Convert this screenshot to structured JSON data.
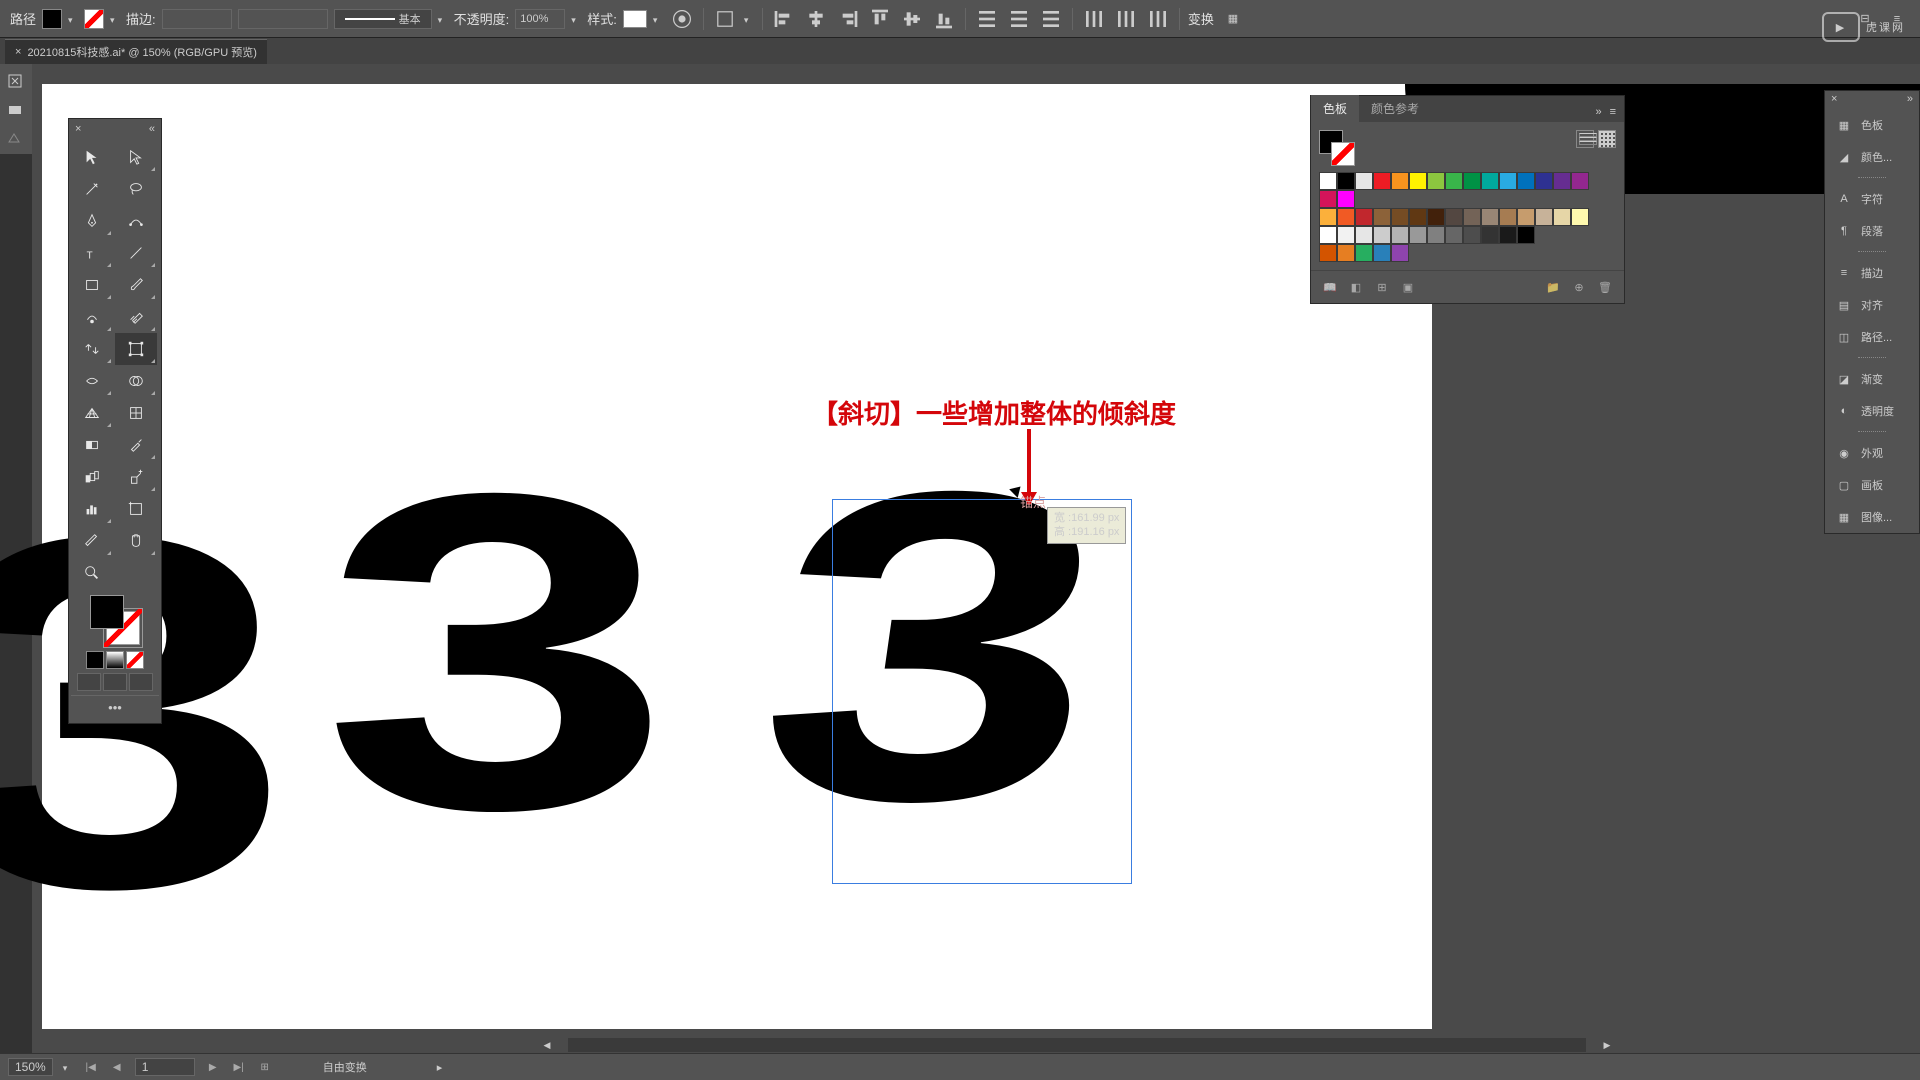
{
  "topbar": {
    "path_label": "路径",
    "stroke_label": "描边:",
    "profile_label": "基本",
    "opacity_label": "不透明度:",
    "opacity_value": "100%",
    "style_label": "样式:",
    "transform_label": "变换"
  },
  "tab": {
    "title": "20210815科技感.ai* @ 150% (RGB/GPU 预览)"
  },
  "canvas": {
    "annotation": "【斜切】一些增加整体的倾斜度",
    "anchor_label": "锚点",
    "tip_w": "宽 :161.99 px",
    "tip_h": "高 :191.16 px"
  },
  "swatches": {
    "tab1": "色板",
    "tab2": "颜色参考",
    "colors_r1": [
      "#fff",
      "#000",
      "#e6e6e6",
      "#ed1c24",
      "#f7931e",
      "#fff200",
      "#8cc63f",
      "#39b54a",
      "#009245",
      "#00a99d",
      "#29abe2",
      "#0071bc",
      "#2e3192",
      "#662d91",
      "#93278f",
      "#d4145a",
      "#ff00ff"
    ],
    "colors_r2": [
      "#fbb03b",
      "#f15a24",
      "#c1272d",
      "#8c6239",
      "#754c24",
      "#603813",
      "#42210b",
      "#534741",
      "#736357",
      "#998675",
      "#a67c52",
      "#c69c6d",
      "#c7b299",
      "#e6d6a7",
      "#fff9ae"
    ],
    "colors_r3": [
      "#fff",
      "#f2f2f2",
      "#e6e6e6",
      "#ccc",
      "#b3b3b3",
      "#999",
      "#808080",
      "#666",
      "#4d4d4d",
      "#333",
      "#1a1a1a",
      "#000"
    ],
    "colors_r4": [
      "#d35400",
      "#e67e22",
      "#27ae60",
      "#2980b9",
      "#8e44ad"
    ]
  },
  "right": {
    "items": [
      "色板",
      "颜色...",
      "字符",
      "段落",
      "描边",
      "对齐",
      "路径...",
      "渐变",
      "透明度",
      "外观",
      "画板",
      "图像..."
    ]
  },
  "status": {
    "zoom": "150%",
    "artboard": "1",
    "tool": "自由变换"
  },
  "watermark": "虎课网"
}
